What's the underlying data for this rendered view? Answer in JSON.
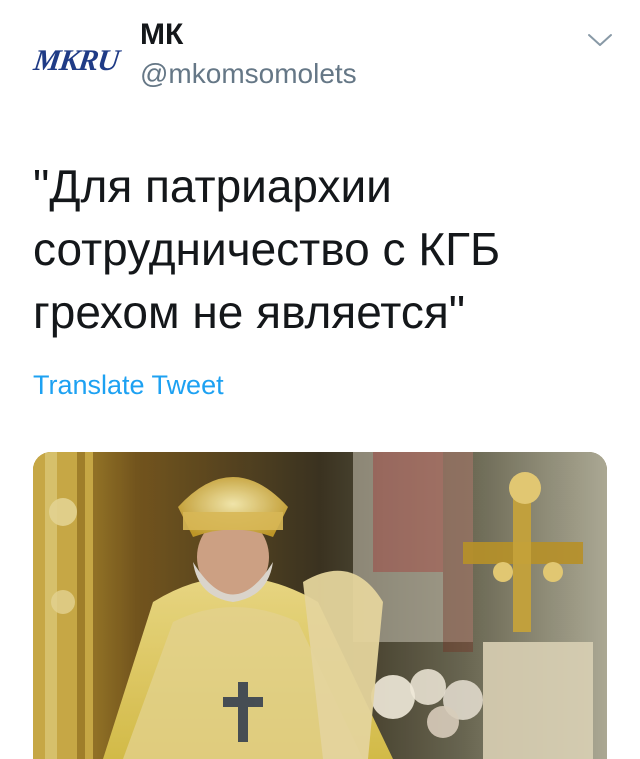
{
  "header": {
    "avatar_logo_text": "MKRU",
    "display_name": "МК",
    "handle": "@mkomsomolets",
    "menu_icon": "chevron-down-icon"
  },
  "tweet": {
    "text": "\"Для патриархии\nсотрудничество с КГБ\nгрехом не является\"",
    "translate_label": "Translate Tweet"
  },
  "colors": {
    "text_primary": "#14171a",
    "text_secondary": "#657786",
    "link": "#1da1f2",
    "logo": "#1f3b86"
  },
  "media": {
    "icon": "photo-icon"
  }
}
